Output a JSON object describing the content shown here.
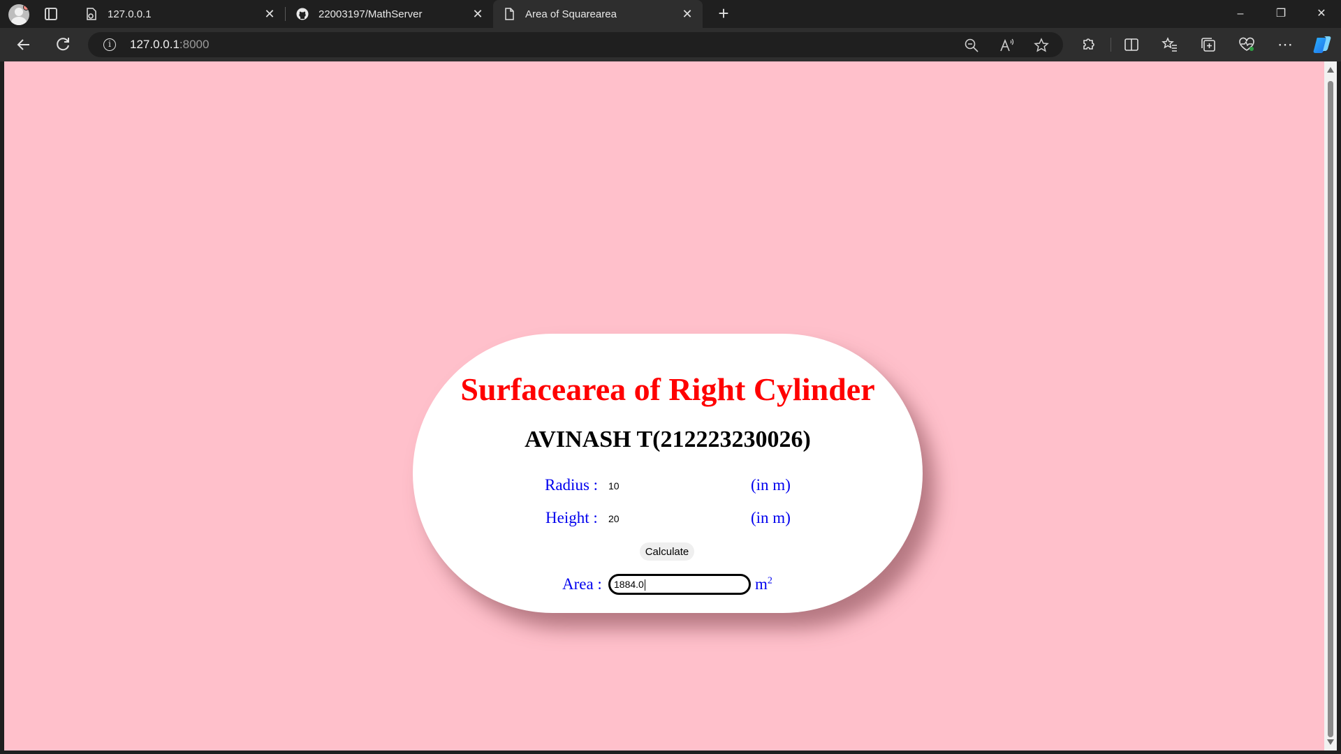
{
  "browser": {
    "tabs": [
      {
        "title": "127.0.0.1",
        "favicon": "page-gear-icon"
      },
      {
        "title": "22003197/MathServer",
        "favicon": "github-icon"
      },
      {
        "title": "Area of Squarearea",
        "favicon": "blank-page-icon",
        "active": true
      }
    ],
    "new_tab_label": "+",
    "address": {
      "host": "127.0.0.1",
      "port": ":8000"
    },
    "window_controls": {
      "minimize": "–",
      "restore": "❐",
      "close": "✕"
    },
    "toolbar_icons": [
      "back-icon",
      "refresh-icon",
      "zoom-out-icon",
      "read-aloud-icon",
      "favorite-star-icon",
      "extensions-icon",
      "split-screen-icon",
      "favorites-icon",
      "collections-icon",
      "performance-icon",
      "more-icon",
      "copilot-icon"
    ]
  },
  "page": {
    "background_color": "#ffc0cb",
    "title": "Surfacearea of Right Cylinder",
    "author": "AVINASH T(212223230026)",
    "radius": {
      "label": "Radius :",
      "value": "10",
      "unit": "(in m)"
    },
    "height": {
      "label": "Height :",
      "value": "20",
      "unit": "(in m)"
    },
    "calculate_label": "Calculate",
    "area": {
      "label": "Area :",
      "value": "1884.0",
      "unit": "m",
      "unit_exponent": "2"
    },
    "colors": {
      "title": "#ff0000",
      "labels": "#0000ee",
      "author": "#000000"
    }
  }
}
